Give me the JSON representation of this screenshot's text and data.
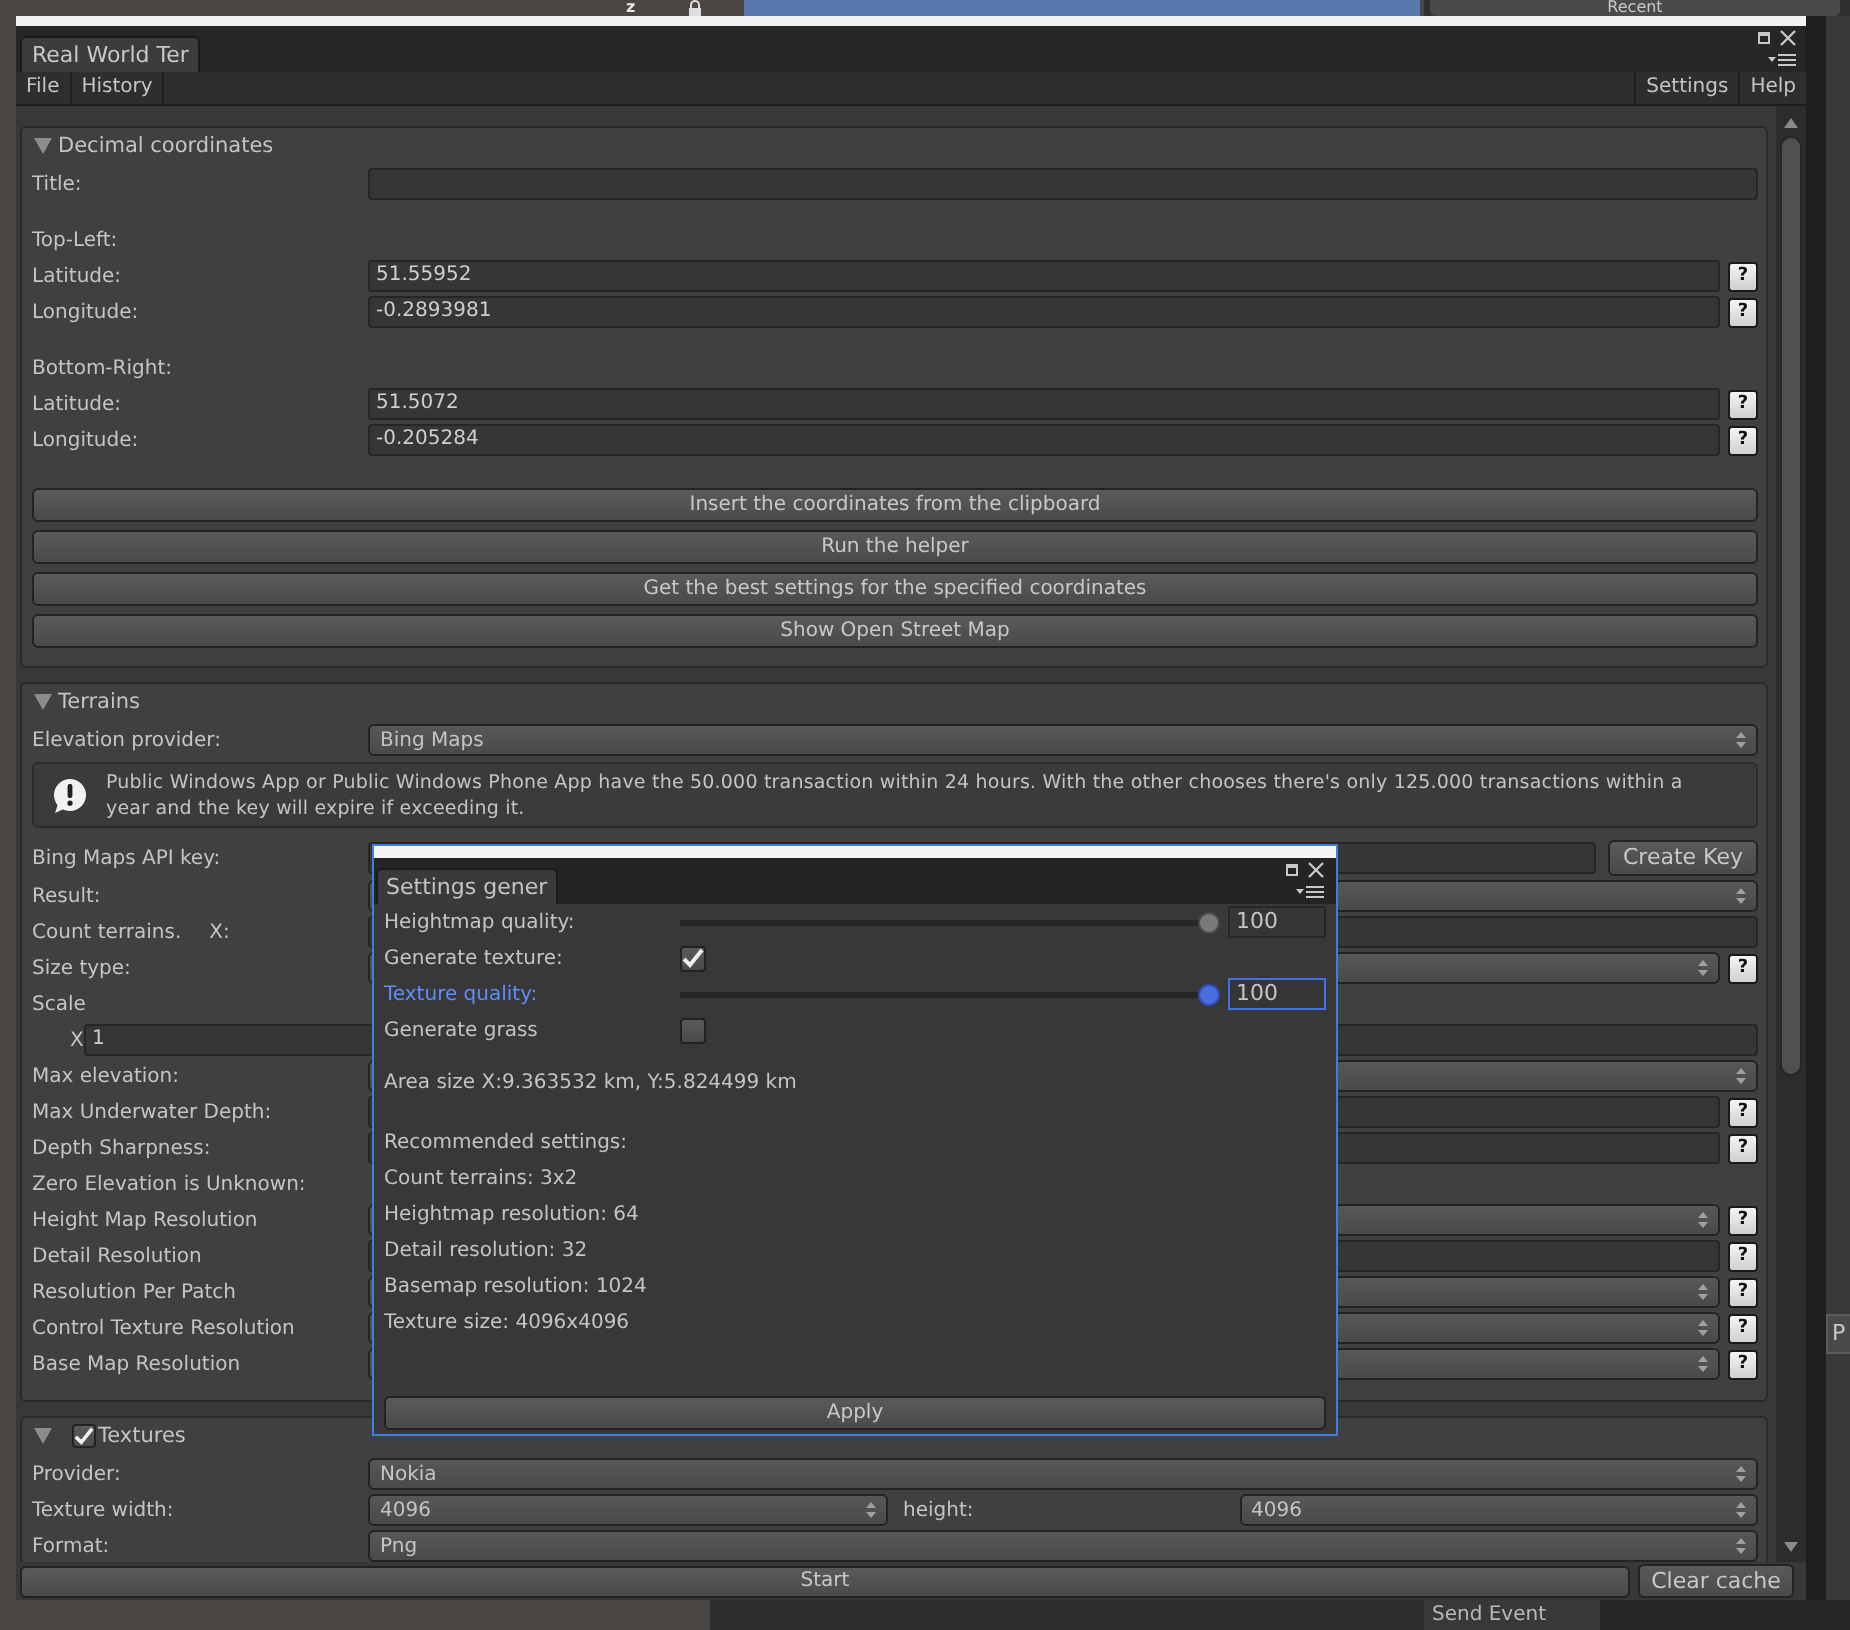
{
  "editor_background": {
    "axis_label": "z",
    "recent_button": "Recent",
    "side_tab": "P",
    "bottom_item": "Send Event"
  },
  "window": {
    "tab": "Real World Ter"
  },
  "menu": {
    "left": [
      "File",
      "History"
    ],
    "right": [
      "Settings",
      "Help"
    ]
  },
  "sections": [
    {
      "title": "Decimal coordinates",
      "expanded": true,
      "rows": [
        {
          "kind": "field",
          "label": "Title:"
        },
        {
          "kind": "heading",
          "label": "Top-Left:"
        },
        {
          "kind": "field",
          "label": "Latitude:",
          "value": "51.55952",
          "help": "?"
        },
        {
          "kind": "field",
          "label": "Longitude:",
          "value": "-0.2893981",
          "help": "?"
        },
        {
          "kind": "heading",
          "label": "Bottom-Right:"
        },
        {
          "kind": "field",
          "label": "Latitude:",
          "value": "51.5072",
          "help": "?"
        },
        {
          "kind": "field",
          "label": "Longitude:",
          "value": "-0.205284",
          "help": "?"
        },
        {
          "kind": "button",
          "label": "Insert the coordinates from the clipboard"
        },
        {
          "kind": "button",
          "label": "Run the helper"
        },
        {
          "kind": "button",
          "label": "Get the best settings for the specified coordinates"
        },
        {
          "kind": "button",
          "label": "Show Open Street Map"
        }
      ]
    },
    {
      "title": "Terrains",
      "expanded": true,
      "rows": [
        {
          "kind": "dropdown",
          "label": "Elevation provider:",
          "value": "Bing Maps"
        },
        {
          "kind": "notice",
          "text": "Public Windows App or Public Windows Phone App have the 50.000 transaction within 24 hours. With the other chooses there's only 125.000 transactions within a year and the key will expire if exceeding it."
        },
        {
          "kind": "field",
          "label": "Bing Maps API key:",
          "action": "Create Key"
        },
        {
          "kind": "dropdown",
          "label": "Result:"
        },
        {
          "kind": "field",
          "label": "Count terrains.",
          "sublabel": "X:"
        },
        {
          "kind": "dropdown",
          "label": "Size type:",
          "help": "?"
        },
        {
          "kind": "label",
          "label": "Scale"
        },
        {
          "kind": "axis_field",
          "label": "X",
          "value": "1"
        },
        {
          "kind": "dropdown",
          "label": "Max elevation:"
        },
        {
          "kind": "field",
          "label": "Max Underwater Depth:",
          "help": "?"
        },
        {
          "kind": "field",
          "label": "Depth Sharpness:",
          "help": "?"
        },
        {
          "kind": "label",
          "label": "Zero Elevation is Unknown:"
        },
        {
          "kind": "dropdown",
          "label": "Height Map Resolution",
          "help": "?"
        },
        {
          "kind": "field",
          "label": "Detail Resolution",
          "help": "?"
        },
        {
          "kind": "dropdown",
          "label": "Resolution Per Patch",
          "help": "?"
        },
        {
          "kind": "dropdown",
          "label": "Control Texture Resolution",
          "help": "?"
        },
        {
          "kind": "dropdown",
          "label": "Base Map Resolution",
          "help": "?"
        }
      ]
    },
    {
      "title": "Textures",
      "expanded": true,
      "toggle": {
        "checked": true
      },
      "rows": [
        {
          "kind": "dropdown",
          "label": "Provider:",
          "value": "Nokia"
        },
        {
          "kind": "dropdown_pair",
          "label": "Texture width:",
          "value": "4096",
          "second_label": "height:",
          "second_value": "4096"
        },
        {
          "kind": "dropdown",
          "label": "Format:",
          "value": "Png"
        }
      ]
    }
  ],
  "footer": {
    "start": "Start",
    "clear": "Clear cache"
  },
  "popup": {
    "tab": "Settings gener",
    "settings": [
      {
        "kind": "slider",
        "label": "Heightmap quality:",
        "level": 1,
        "value": "100",
        "focused": false
      },
      {
        "kind": "checkbox",
        "label": "Generate texture:",
        "checked": true,
        "focused": false
      },
      {
        "kind": "slider",
        "label": "Texture quality:",
        "level": 1,
        "value": "100",
        "focused": true
      },
      {
        "kind": "checkbox",
        "label": "Generate grass",
        "checked": false,
        "focused": false
      }
    ],
    "info": [
      [
        "Area size X:9.363532 km, Y:5.824499 km"
      ],
      [
        "Recommended settings:",
        "Count terrains: 3x2",
        "Heightmap resolution: 64",
        "Detail resolution: 32",
        "Basemap resolution: 1024",
        "Texture size: 4096x4096"
      ]
    ],
    "apply": "Apply"
  }
}
